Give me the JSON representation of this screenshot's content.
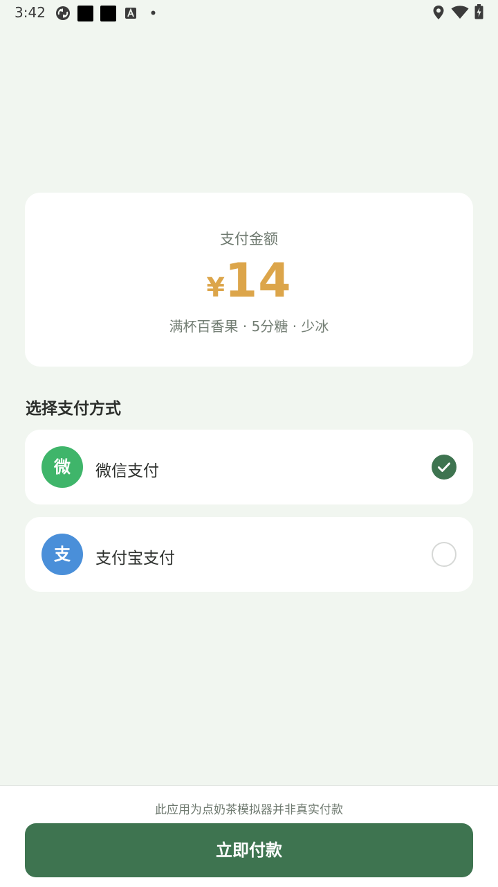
{
  "status_bar": {
    "time": "3:42",
    "left_icons": [
      "sync-icon",
      "square-notification-icon",
      "square-notification-icon",
      "font-a-icon",
      "dot-icon"
    ],
    "right_icons": [
      "location-icon",
      "wifi-icon",
      "battery-charging-icon"
    ]
  },
  "amount_card": {
    "label": "支付金额",
    "currency": "¥",
    "amount": "14",
    "description": "满杯百香果 · 5分糖 · 少冰"
  },
  "payment_section": {
    "title": "选择支付方式",
    "options": [
      {
        "avatar": "微",
        "label": "微信支付",
        "selected": true,
        "color": "#3fb56a"
      },
      {
        "avatar": "支",
        "label": "支付宝支付",
        "selected": false,
        "color": "#4a8fd9"
      }
    ]
  },
  "footer": {
    "disclaimer": "此应用为点奶茶模拟器并非真实付款",
    "pay_button": "立即付款"
  },
  "colors": {
    "background": "#f1f6f0",
    "accent": "#3e7450",
    "amount": "#dca54a",
    "wechat": "#3fb56a",
    "alipay": "#4a8fd9"
  }
}
